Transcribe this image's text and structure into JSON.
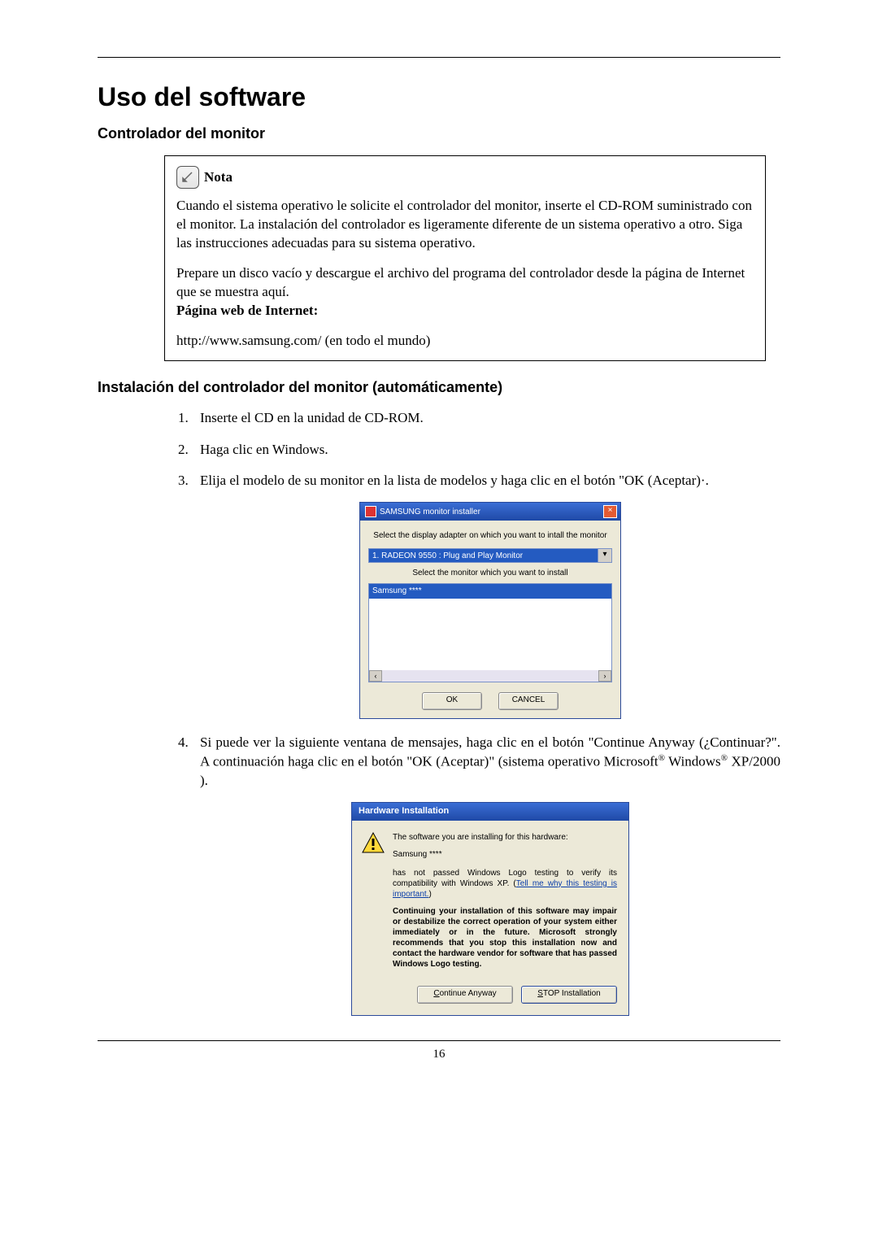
{
  "headings": {
    "h1": "Uso del software",
    "h2a": "Controlador del monitor",
    "h2b": "Instalación del controlador del monitor (automáticamente)"
  },
  "note": {
    "title": "Nota",
    "p1": "Cuando el sistema operativo le solicite el controlador del monitor, inserte el CD-ROM suministrado con el monitor. La instalación del controlador es ligeramente diferente de un sistema operativo a otro. Siga las instrucciones adecuadas para su sistema operativo.",
    "p2": "Prepare un disco vacío y descargue el archivo del programa del controlador desde la página de Internet que se muestra aquí.",
    "bold_line": "Página web de Internet:",
    "url": "http://www.samsung.com/ (en todo el mundo)"
  },
  "steps": {
    "s1": "Inserte el CD en la unidad de CD-ROM.",
    "s2": "Haga clic en Windows.",
    "s3": "Elija el modelo de su monitor en la lista de modelos y haga clic en el botón \"OK (Aceptar)·.",
    "s4_prefix": "Si puede ver la siguiente ventana de mensajes, haga clic en el botón \"Continue Anyway (¿Continuar?\". A continuación haga clic en el botón \"OK (Aceptar)\" (sistema operativo Microsoft",
    "s4_mid": " Windows",
    "s4_suffix": " XP/2000 )."
  },
  "dlg1": {
    "title": "SAMSUNG monitor installer",
    "instr1": "Select the display adapter on which you want to intall the monitor",
    "combo": "1. RADEON 9550 : Plug and Play Monitor",
    "instr2": "Select the monitor which you want to install",
    "listsel": "Samsung ****",
    "ok": "OK",
    "cancel": "CANCEL"
  },
  "dlg2": {
    "title": "Hardware Installation",
    "line1": "The software you are installing for this hardware:",
    "device": "Samsung ****",
    "line2a": "has not passed Windows Logo testing to verify its compatibility with Windows XP. (",
    "link": "Tell me why this testing is important.",
    "line2b": ")",
    "warn": "Continuing your installation of this software may impair or destabilize the correct operation of your system either immediately or in the future. Microsoft strongly recommends that you stop this installation now and contact the hardware vendor for software that has passed Windows Logo testing.",
    "btn_continue": "Continue Anyway",
    "btn_stop": "STOP Installation"
  },
  "page_number": "16"
}
